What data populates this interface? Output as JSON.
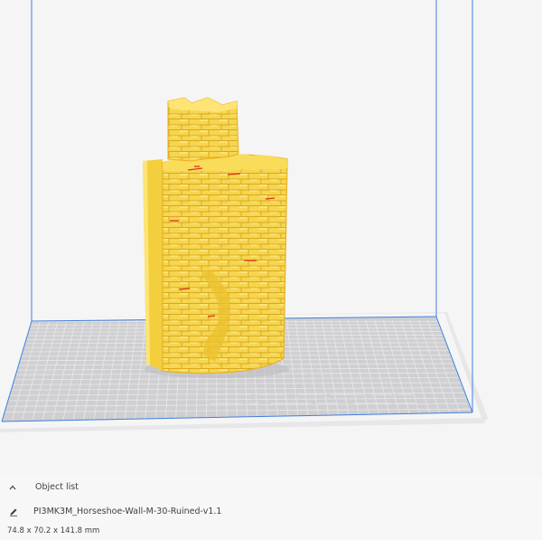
{
  "panel": {
    "object_list_label": "Object list",
    "file_name": "PI3MK3M_Horseshoe-Wall-M-30-Ruined-v1.1",
    "dimensions": "74.8 x 70.2 x 141.8 mm"
  },
  "icons": {
    "object_list_toggle": "chevron-up-icon",
    "edit_name": "pencil-icon"
  },
  "colors": {
    "viewport_background": "#f5f5f5",
    "build_volume_edge": "#3f7fe0",
    "build_plate": "#cfcfd2",
    "grid_line": "#e4e4e6",
    "model_fill": "#f6d64e",
    "model_highlight": "#fde474",
    "model_shadow": "#e8b020",
    "overhang_marking": "#e0301c"
  }
}
